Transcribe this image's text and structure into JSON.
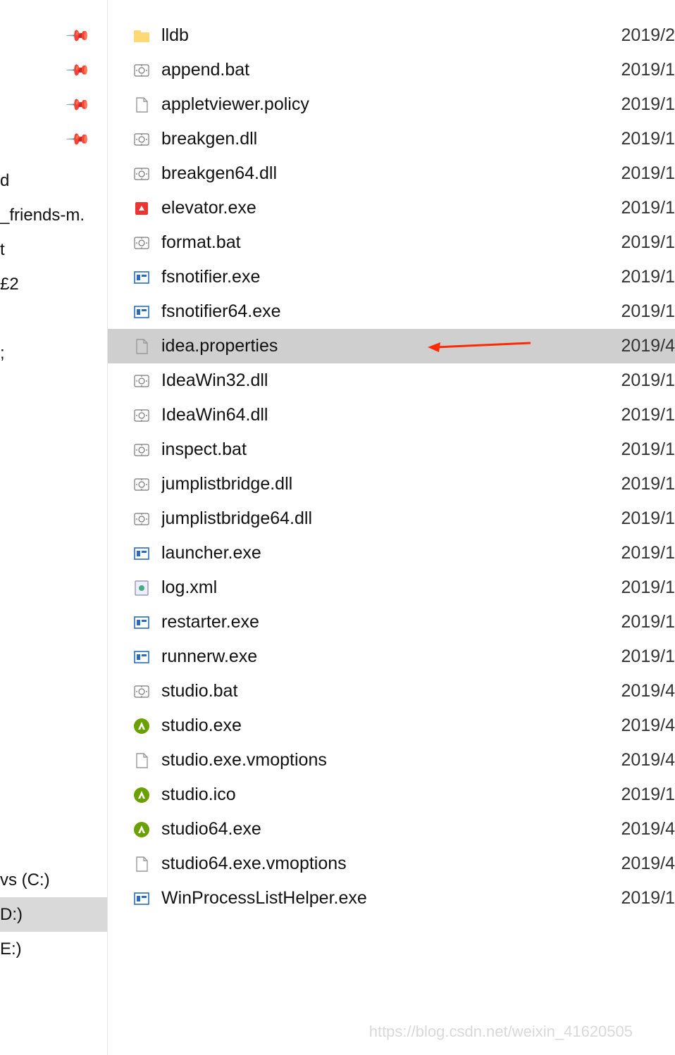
{
  "sidebar": {
    "pins": [
      "",
      "",
      "",
      ""
    ],
    "items": [
      {
        "label": "d",
        "sel": false
      },
      {
        "label": "_friends-m.",
        "sel": false
      },
      {
        "label": "t",
        "sel": false
      },
      {
        "label": "£2",
        "sel": false
      },
      {
        "label": "",
        "sel": false
      },
      {
        "label": ";",
        "sel": false
      }
    ],
    "drives": [
      {
        "label": "vs (C:)",
        "sel": false
      },
      {
        "label": "D:)",
        "sel": true
      },
      {
        "label": "E:)",
        "sel": false
      }
    ]
  },
  "files": [
    {
      "icon": "folder",
      "name": "lldb",
      "date": "2019/2",
      "sel": false
    },
    {
      "icon": "gear",
      "name": "append.bat",
      "date": "2019/1",
      "sel": false
    },
    {
      "icon": "doc",
      "name": "appletviewer.policy",
      "date": "2019/1",
      "sel": false
    },
    {
      "icon": "gear",
      "name": "breakgen.dll",
      "date": "2019/1",
      "sel": false
    },
    {
      "icon": "gear",
      "name": "breakgen64.dll",
      "date": "2019/1",
      "sel": false
    },
    {
      "icon": "elev",
      "name": "elevator.exe",
      "date": "2019/1",
      "sel": false
    },
    {
      "icon": "gear",
      "name": "format.bat",
      "date": "2019/1",
      "sel": false
    },
    {
      "icon": "exe",
      "name": "fsnotifier.exe",
      "date": "2019/1",
      "sel": false
    },
    {
      "icon": "exe",
      "name": "fsnotifier64.exe",
      "date": "2019/1",
      "sel": false
    },
    {
      "icon": "doc",
      "name": "idea.properties",
      "date": "2019/4",
      "sel": true,
      "arrow": true
    },
    {
      "icon": "gear",
      "name": "IdeaWin32.dll",
      "date": "2019/1",
      "sel": false
    },
    {
      "icon": "gear",
      "name": "IdeaWin64.dll",
      "date": "2019/1",
      "sel": false
    },
    {
      "icon": "gear",
      "name": "inspect.bat",
      "date": "2019/1",
      "sel": false
    },
    {
      "icon": "gear",
      "name": "jumplistbridge.dll",
      "date": "2019/1",
      "sel": false
    },
    {
      "icon": "gear",
      "name": "jumplistbridge64.dll",
      "date": "2019/1",
      "sel": false
    },
    {
      "icon": "exe",
      "name": "launcher.exe",
      "date": "2019/1",
      "sel": false
    },
    {
      "icon": "xml",
      "name": "log.xml",
      "date": "2019/1",
      "sel": false
    },
    {
      "icon": "exe",
      "name": "restarter.exe",
      "date": "2019/1",
      "sel": false
    },
    {
      "icon": "exe",
      "name": "runnerw.exe",
      "date": "2019/1",
      "sel": false
    },
    {
      "icon": "gear",
      "name": "studio.bat",
      "date": "2019/4",
      "sel": false
    },
    {
      "icon": "studio",
      "name": "studio.exe",
      "date": "2019/4",
      "sel": false
    },
    {
      "icon": "doc",
      "name": "studio.exe.vmoptions",
      "date": "2019/4",
      "sel": false
    },
    {
      "icon": "studio",
      "name": "studio.ico",
      "date": "2019/1",
      "sel": false
    },
    {
      "icon": "studio",
      "name": "studio64.exe",
      "date": "2019/4",
      "sel": false
    },
    {
      "icon": "doc",
      "name": "studio64.exe.vmoptions",
      "date": "2019/4",
      "sel": false
    },
    {
      "icon": "exe",
      "name": "WinProcessListHelper.exe",
      "date": "2019/1",
      "sel": false
    }
  ],
  "watermark": "https://blog.csdn.net/weixin_41620505"
}
